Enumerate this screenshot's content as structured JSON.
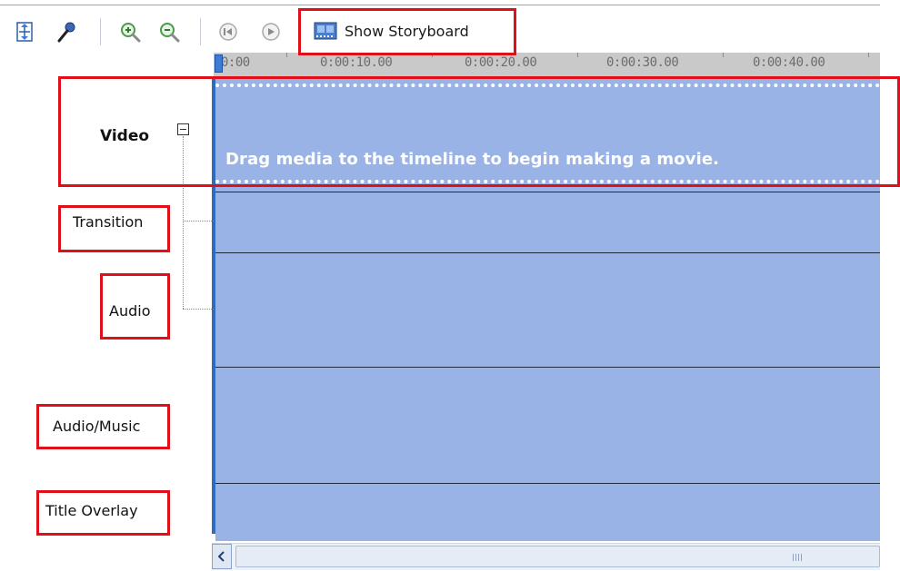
{
  "toolbar": {
    "icons": [
      "set-audio-levels-icon",
      "narrate-timeline-icon",
      "zoom-in-icon",
      "zoom-out-icon",
      "rewind-icon",
      "play-icon",
      "storyboard-icon"
    ],
    "show_storyboard_label": "Show Storyboard"
  },
  "ruler": {
    "ticks": [
      "0:00",
      "0:00:10.00",
      "0:00:20.00",
      "0:00:30.00",
      "0:00:40.00"
    ]
  },
  "timeline": {
    "drag_hint": "Drag media to the timeline to begin making a movie."
  },
  "tracks": {
    "video": "Video",
    "transition": "Transition",
    "audio": "Audio",
    "audio_music": "Audio/Music",
    "title_overlay": "Title Overlay"
  },
  "colors": {
    "timeline_bg": "#9ab3e6",
    "highlight": "#e0101a",
    "ruler_bg": "#c9c9c9"
  }
}
